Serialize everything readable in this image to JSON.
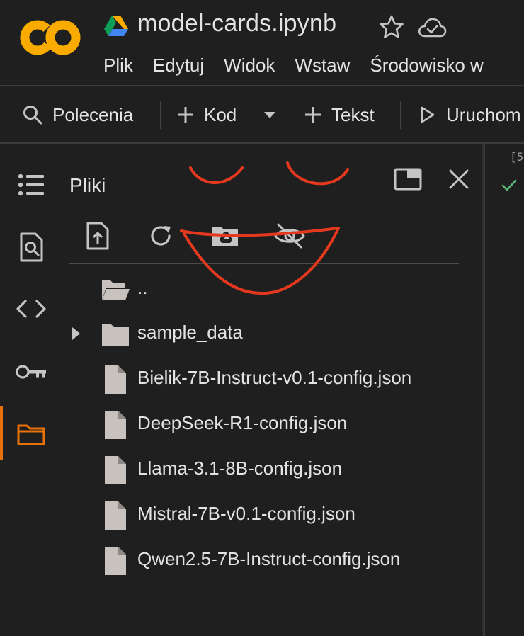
{
  "header": {
    "notebook_title": "model-cards.ipynb",
    "menu": [
      "Plik",
      "Edytuj",
      "Widok",
      "Wstaw",
      "Środowisko w"
    ]
  },
  "toolbar": {
    "commands_label": "Polecenia",
    "add_code_label": "Kod",
    "add_text_label": "Tekst",
    "run_label": "Uruchom"
  },
  "files_panel": {
    "title": "Pliki",
    "parent_dir": "..",
    "folder": "sample_data",
    "files": [
      "Bielik-7B-Instruct-v0.1-config.json",
      "DeepSeek-R1-config.json",
      "Llama-3.1-8B-config.json",
      "Mistral-7B-v0.1-config.json",
      "Qwen2.5-7B-Instruct-config.json"
    ]
  },
  "cell": {
    "exec_count": "[5"
  },
  "colors": {
    "background": "#1f1f1f",
    "text": "#e3e3e3",
    "icon": "#c4c4c4",
    "file_icon": "#c7c2bd",
    "accent_orange": "#e8710a",
    "logo_orange": "#f9ab00",
    "success_green": "#5bb974",
    "annotation_red": "#e5391f"
  },
  "icons": {
    "logo": "colab-logo",
    "drive": "google-drive-icon",
    "star": "star-icon",
    "cloud": "cloud-check-icon",
    "rail": [
      "toc-icon",
      "find-replace-icon",
      "code-snippets-icon",
      "key-icon",
      "folder-icon"
    ],
    "panel_actions": [
      "upload-icon",
      "refresh-icon",
      "mount-drive-icon",
      "hide-files-icon"
    ]
  }
}
